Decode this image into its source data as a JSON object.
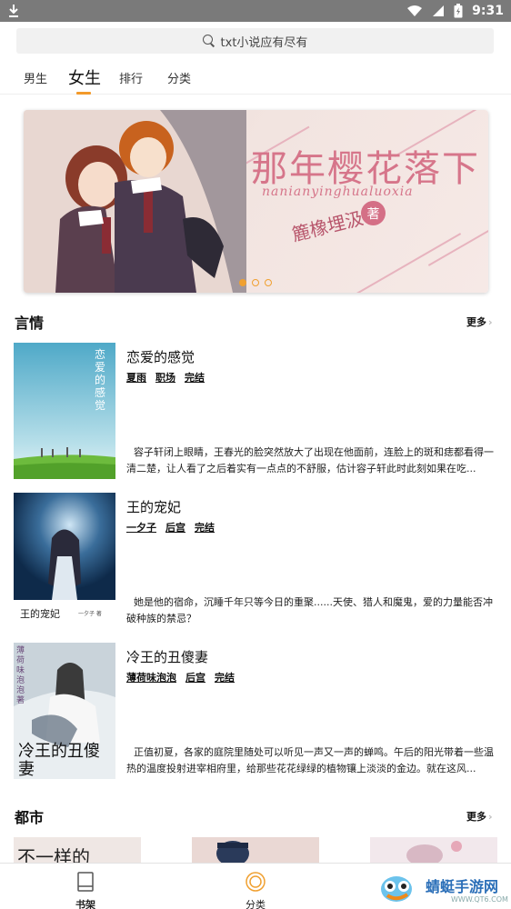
{
  "status_bar": {
    "time": "9:31",
    "icons": [
      "download-icon",
      "wifi-icon",
      "signal-icon",
      "battery-icon"
    ]
  },
  "search": {
    "text": "txt小说应有尽有",
    "icon": "search-icon"
  },
  "tabs": [
    {
      "label": "男生",
      "active": false
    },
    {
      "label": "女生",
      "active": true
    },
    {
      "label": "排行",
      "active": false
    },
    {
      "label": "分类",
      "active": false
    }
  ],
  "banner": {
    "title": "那年樱花落下",
    "subtitle": "nanianyinghualuoxia",
    "author": "簏橡埋汲",
    "badge": "著",
    "page_count": 3,
    "active_index": 0
  },
  "sections": {
    "yanqing": {
      "title": "言情",
      "more": "更多"
    },
    "dushi": {
      "title": "都市",
      "more": "更多"
    }
  },
  "books": [
    {
      "title": "恋爱的感觉",
      "cover_text": "恋爱的感觉",
      "tags": [
        "夏雨",
        "职场",
        "完结"
      ],
      "desc": "容子轩闭上眼睛，王春光的脸突然放大了出现在他面前，连脸上的斑和痣都看得一清二楚，让人看了之后着实有一点点的不舒服，估计容子轩此时此刻如果在吃..."
    },
    {
      "title": "王的宠妃",
      "cover_text": "王的宠妃",
      "cover_author": "一夕子 著",
      "tags": [
        "一夕子",
        "后宫",
        "完结"
      ],
      "desc": "她是他的宿命，沉睡千年只等今日的重聚......天使、猎人和魔鬼，爱的力量能否冲破种族的禁忌？"
    },
    {
      "title": "冷王的丑傻妻",
      "cover_text": "冷王的丑傻妻",
      "cover_author": "薄荷味泡泡 著",
      "tags": [
        "薄荷味泡泡",
        "后宫",
        "完结"
      ],
      "desc": "正值初夏，各家的庭院里随处可以听见一声又一声的蝉鸣。午后的阳光带着一些温热的温度投射进宰相府里，给那些花花绿绿的植物镶上淡淡的金边。就在这风..."
    }
  ],
  "dushi_cover_text": "不一样的",
  "bottom_nav": [
    {
      "label": "书架",
      "icon": "book-icon"
    },
    {
      "label": "分类",
      "icon": "target-icon"
    }
  ],
  "watermark": {
    "text": "蜻蜓手游网",
    "url": "WWW.QT6.COM"
  },
  "colors": {
    "accent": "#f39a2a",
    "banner_text": "#d6758a",
    "status_bar": "#7a7a7a"
  }
}
